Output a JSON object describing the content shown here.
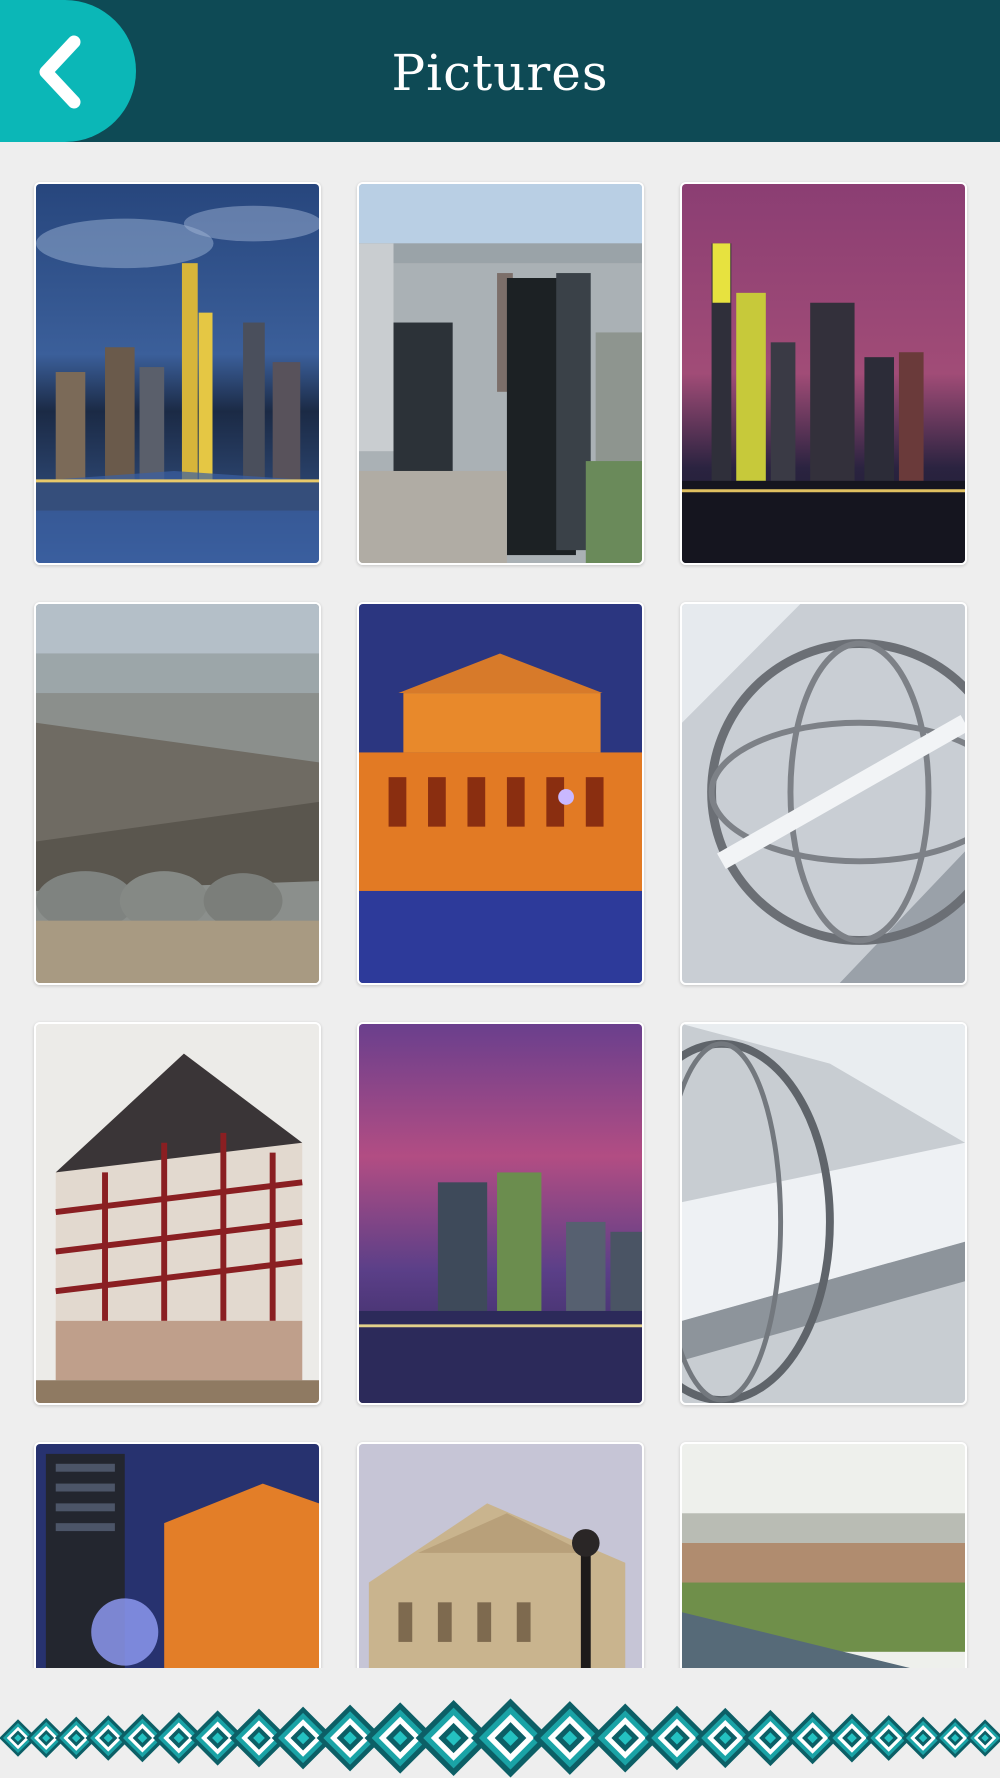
{
  "header": {
    "title": "Pictures",
    "back_icon": "chevron-left-icon",
    "background_color": "#0e4a55",
    "accent_color": "#0bb7b7"
  },
  "gallery": {
    "items": [
      {
        "subject": "skyline-night-blue"
      },
      {
        "subject": "skyscrapers-aerial"
      },
      {
        "subject": "skyline-dusk-purple"
      },
      {
        "subject": "rail-yard-aerial"
      },
      {
        "subject": "opera-house-night"
      },
      {
        "subject": "sphere-architecture"
      },
      {
        "subject": "half-timbered-house"
      },
      {
        "subject": "towers-purple-sky"
      },
      {
        "subject": "glass-sphere-interior"
      },
      {
        "subject": "tower-and-opera-night"
      },
      {
        "subject": "opera-house-day"
      },
      {
        "subject": "river-town-aerial"
      }
    ]
  },
  "footer": {
    "pattern": "teal-diamond-border"
  }
}
